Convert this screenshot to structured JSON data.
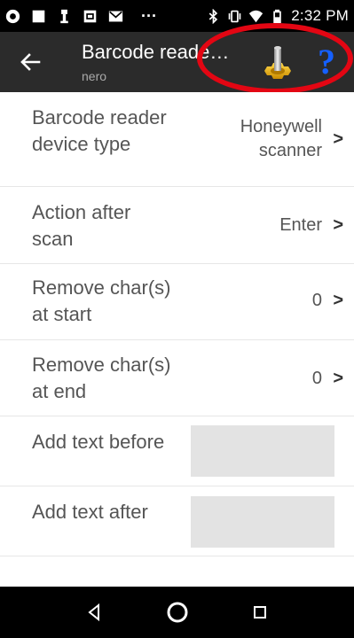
{
  "status_bar": {
    "time": "2:32 PM",
    "icons_left": [
      "app-notification-icon",
      "square-notification-icon",
      "usb-icon",
      "image-notification-icon",
      "email-icon",
      "more-notifications-icon"
    ],
    "icons_right": [
      "bluetooth-icon",
      "vibrate-icon",
      "wifi-icon",
      "battery-icon"
    ],
    "more_symbol": "···"
  },
  "app_bar": {
    "title": "Barcode reade…",
    "subtitle": "nero",
    "back_icon": "arrow-back-icon",
    "settings_icon": "gear-settings-icon",
    "help_label": "?",
    "annotation_color": "#e30613",
    "background": "#2b2b2b",
    "help_color": "#1560ff"
  },
  "settings": {
    "device_type": {
      "label_line1": "Barcode reader",
      "label_line2": "device type",
      "value_line1": "Honeywell",
      "value_line2": "scanner",
      "chevron": ">"
    },
    "action_after_scan": {
      "label_line1": "Action after",
      "label_line2": "scan",
      "value": "Enter",
      "chevron": ">"
    },
    "remove_start": {
      "label_line1": "Remove char(s)",
      "label_line2": "at start",
      "value": "0",
      "chevron": ">"
    },
    "remove_end": {
      "label_line1": "Remove char(s)",
      "label_line2": "at end",
      "value": "0",
      "chevron": ">"
    },
    "add_before": {
      "label": "Add text before",
      "value": ""
    },
    "add_after": {
      "label": "Add text after",
      "value": ""
    }
  },
  "nav_bar": {
    "back": "nav-back-icon",
    "home": "nav-home-icon",
    "recents": "nav-recents-icon"
  }
}
